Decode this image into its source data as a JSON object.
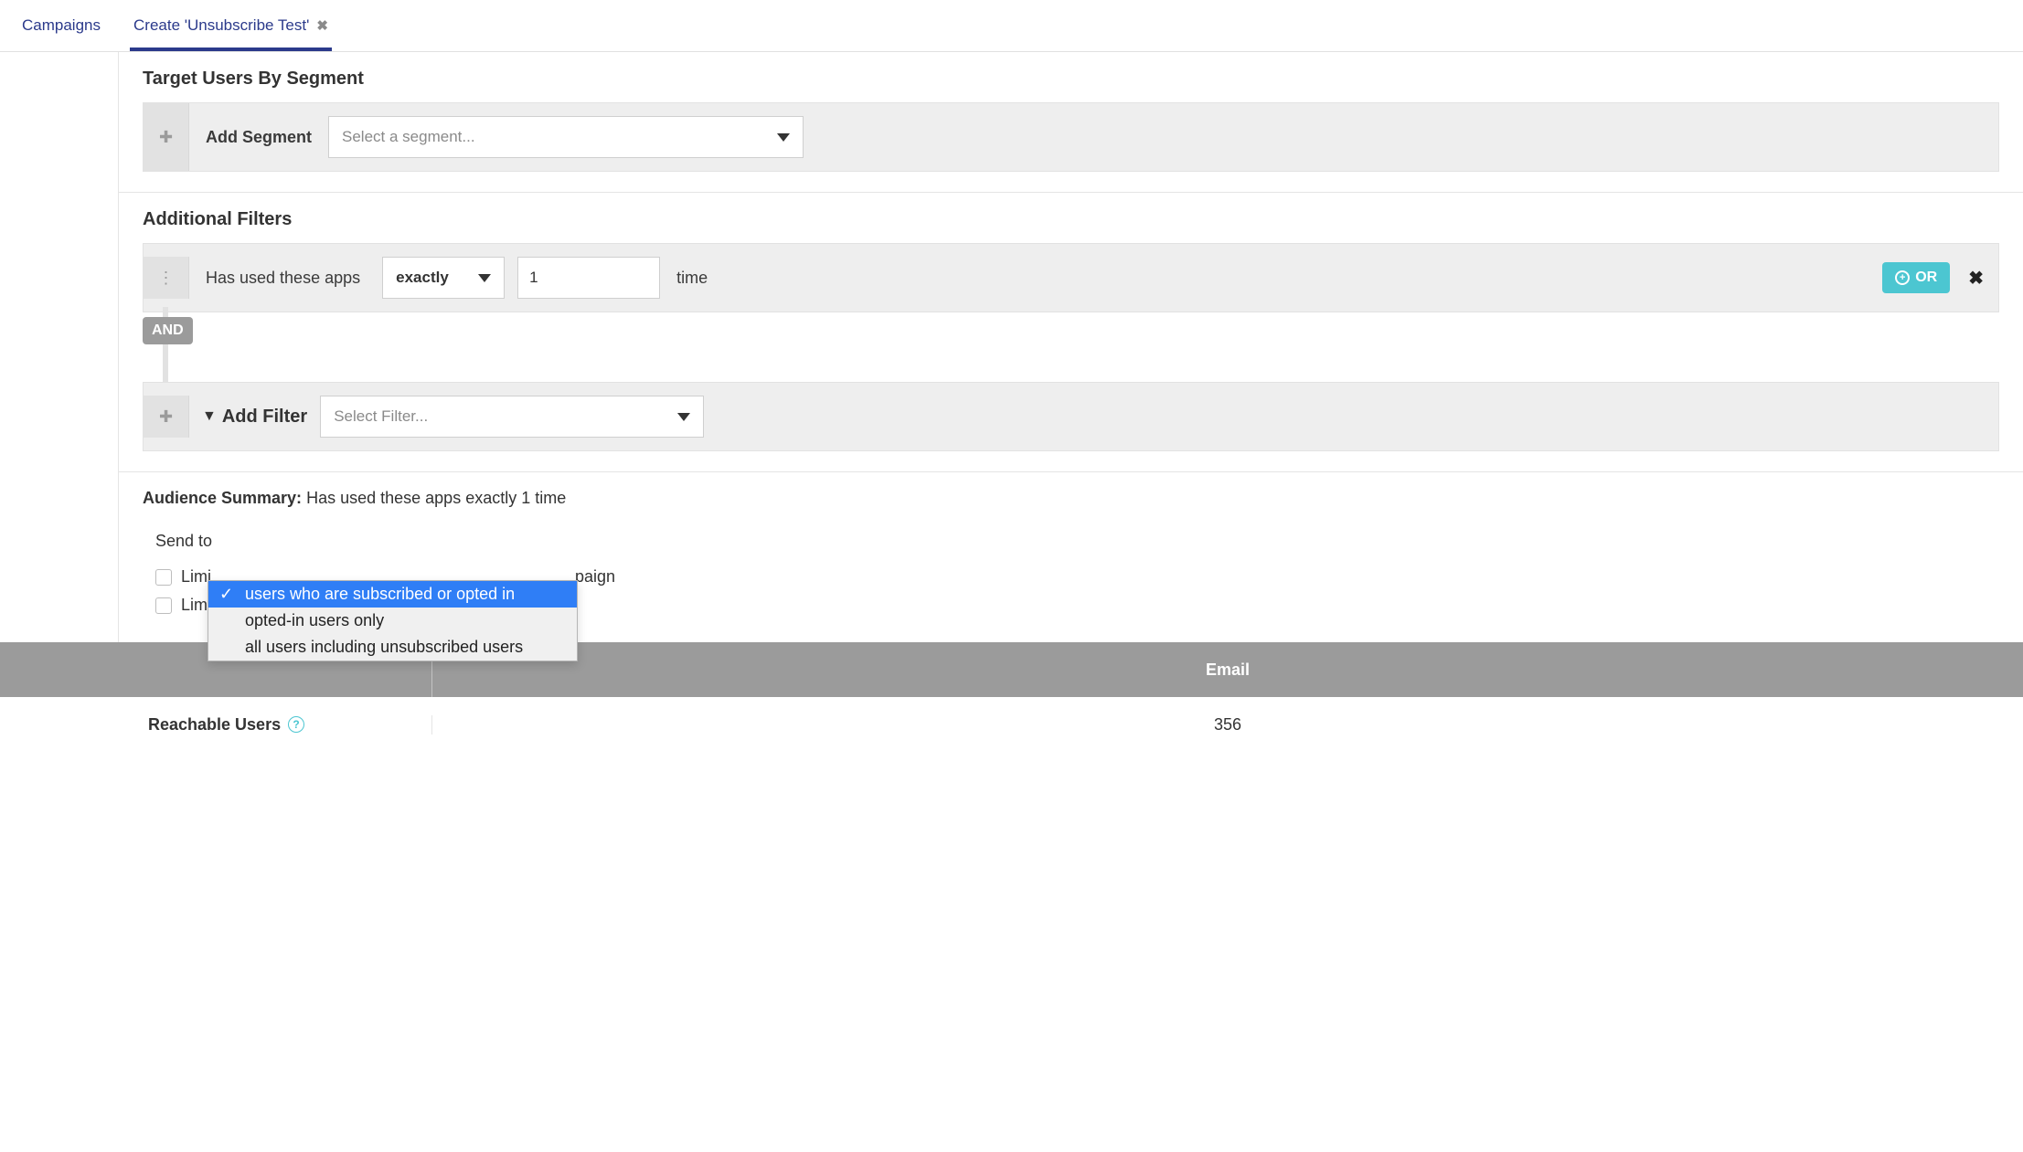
{
  "tabs": {
    "campaigns": "Campaigns",
    "create": "Create 'Unsubscribe Test'"
  },
  "segment": {
    "title": "Target Users By Segment",
    "add_label": "Add Segment",
    "placeholder": "Select a segment..."
  },
  "filters": {
    "title": "Additional Filters",
    "row1_text": "Has used these apps",
    "row1_mode": "exactly",
    "row1_count": "1",
    "row1_unit": "time",
    "or_label": "OR",
    "and_label": "AND",
    "add_filter_label": "Add Filter",
    "select_filter_placeholder": "Select Filter..."
  },
  "audience": {
    "label": "Audience Summary:",
    "text": "Has used these apps exactly 1 time",
    "send_to_label": "Send to",
    "dropdown": {
      "opt1": "users who are subscribed or opted in",
      "opt2": "opted-in users only",
      "opt3": "all users including unsubscribed users"
    },
    "limit_users": "Limit the number of users who receive this Campaign",
    "limit_users_truncated_prefix": "Limi",
    "limit_users_truncated_suffix": "paign",
    "limit_rate": "Limit the rate at which this Campaign will send"
  },
  "stats": {
    "col_email": "Email",
    "reachable_label": "Reachable Users",
    "reachable_value": "356"
  }
}
